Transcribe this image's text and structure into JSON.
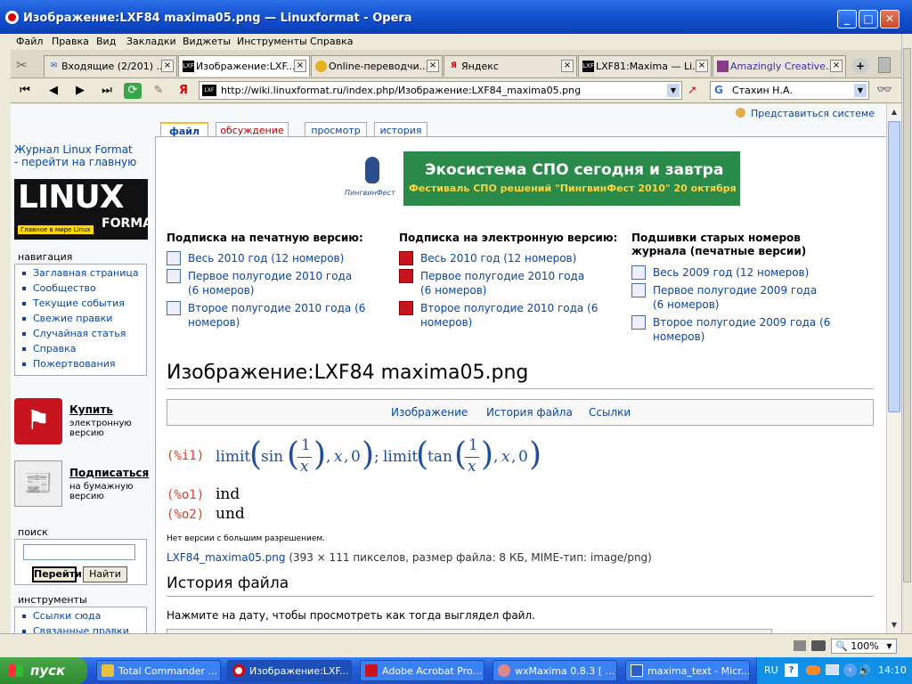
{
  "window": {
    "title": "Изображение:LXF84 maxima05.png — Linuxformat - Opera"
  },
  "menu": [
    "Файл",
    "Правка",
    "Вид",
    "Закладки",
    "Виджеты",
    "Инструменты",
    "Справка"
  ],
  "tabs": [
    {
      "label": "Входящие (2/201) ..."
    },
    {
      "label": "Изображение:LXF..."
    },
    {
      "label": "Online-переводчи..."
    },
    {
      "label": "Яндекс"
    },
    {
      "label": "LXF81:Maxima — Li..."
    },
    {
      "label": "Amazingly Creative..."
    }
  ],
  "address": {
    "url": "http://wiki.linuxformat.ru/index.php/Изображение:LXF84_maxima05.png",
    "search": "Стахин Н.А."
  },
  "page": {
    "login": "Представиться системе",
    "tabs": [
      "файл",
      "обсуждение",
      "просмотр",
      "история"
    ],
    "journal_link": "Журнал Linux Format - перейти на главную",
    "logo_main": "LINUX",
    "logo_sub": "FORMAT",
    "logo_tag": "Главное в мире Linux",
    "nav_title": "навигация",
    "nav": [
      "Заглавная страница",
      "Сообщество",
      "Текущие события",
      "Свежие правки",
      "Случайная статья",
      "Справка",
      "Пожертвования"
    ],
    "buy": {
      "title": "Купить",
      "sub": "электронную версию"
    },
    "subscribe": {
      "title": "Подписаться",
      "sub": "на бумажную версию"
    },
    "search_title": "поиск",
    "search_go": "Перейти",
    "search_find": "Найти",
    "tools_title": "инструменты",
    "tools": [
      "Ссылки сюда",
      "Связанные правки"
    ],
    "banner": {
      "brand": "ПингвинФест",
      "title": "Экосистема СПО сегодня и завтра",
      "subtitle": "Фестиваль СПО решений \"ПингвинФест 2010\" 20 октября"
    },
    "col1": {
      "head": "Подписка на печатную версию:",
      "items": [
        "Весь 2010 год (12 номеров)",
        "Первое полугодие 2010 года (6 номеров)",
        "Второе полугодие 2010 года (6 номеров)"
      ]
    },
    "col2": {
      "head": "Подписка на электронную версию:",
      "items": [
        "Весь 2010 год (12 номеров)",
        "Первое полугодие 2010 года (6 номеров)",
        "Второе полугодие 2010 года (6 номеров)"
      ]
    },
    "col3": {
      "head": "Подшивки старых номеров журнала (печатные версии)",
      "items": [
        "Весь 2009 год (12 номеров)",
        "Первое полугодие 2009 года (6 номеров)",
        "Второе полугодие 2009 года (6 номеров)"
      ]
    },
    "heading": "Изображение:LXF84 maxima05.png",
    "filetabs": [
      "Изображение",
      "История файла",
      "Ссылки"
    ],
    "maxima": {
      "i1": "(%i1)",
      "o1": "(%o1)",
      "o2": "(%o2)",
      "o1val": "ind",
      "o2val": "und",
      "func": "limit",
      "sin": "sin",
      "tan": "tan",
      "one": "1",
      "x": "x",
      "zero": "0",
      "sep": ";"
    },
    "noversion": "Нет версии с большим разрешением.",
    "filelink": "LXF84_maxima05.png",
    "fileinfo": " (393 × 111 пикселов, размер файла: 8 КБ, MIME-тип: image/png)",
    "history_heading": "История файла",
    "history_note": "Нажмите на дату, чтобы просмотреть как тогда выглядел файл."
  },
  "status": {
    "zoom": "100%"
  },
  "taskbar": {
    "start": "пуск",
    "tasks": [
      "Total Commander ...",
      "Изображение:LXF...",
      "Adobe Acrobat Pro...",
      "wxMaxima 0.8.3 [ ...",
      "maxima_text - Micr..."
    ],
    "lang": "RU",
    "clock": "14:10"
  },
  "colors": {
    "accent": "#0645ad",
    "banner": "#2a8a4a",
    "banner_text_sub": "#ffd23a",
    "maxima_label": "#d6422b"
  }
}
